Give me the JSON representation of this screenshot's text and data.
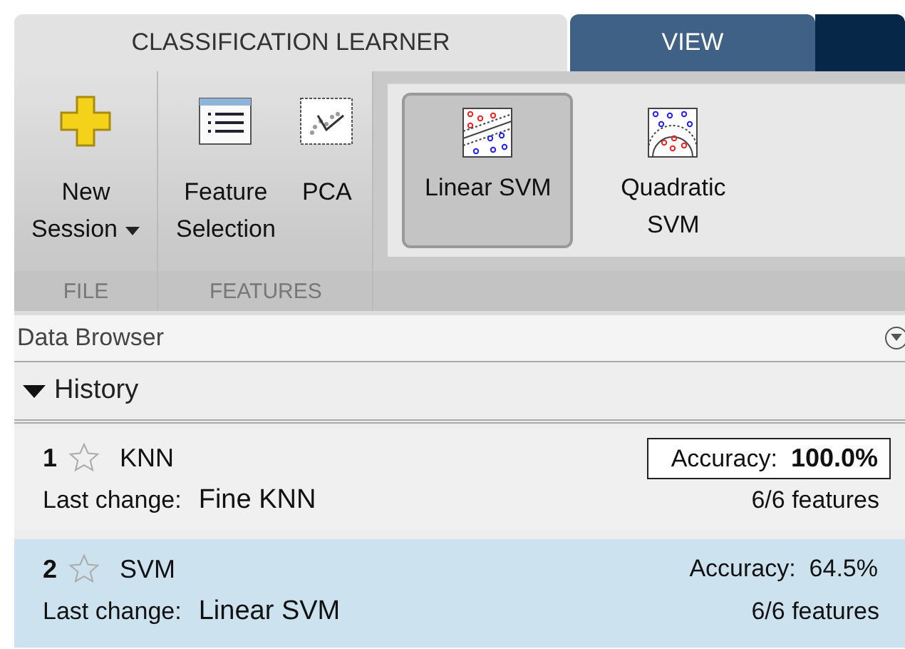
{
  "tabs": [
    {
      "label": "CLASSIFICATION LEARNER",
      "selected": true
    },
    {
      "label": "VIEW",
      "selected": false
    }
  ],
  "ribbon": {
    "sections": [
      {
        "label": "FILE",
        "buttons": [
          {
            "kind": "new",
            "label": [
              "New",
              "Session"
            ],
            "dropdown": true
          }
        ]
      },
      {
        "label": "FEATURES",
        "buttons": [
          {
            "kind": "feature",
            "label": [
              "Feature",
              "Selection"
            ],
            "dropdown": false
          },
          {
            "kind": "pca",
            "label": [
              "PCA"
            ],
            "dropdown": false
          }
        ]
      }
    ],
    "gallery": [
      {
        "kind": "linear-svm",
        "label": [
          "Linear SVM"
        ],
        "selected": true
      },
      {
        "kind": "quadratic-svm",
        "label": [
          "Quadratic",
          "SVM"
        ],
        "selected": false
      }
    ]
  },
  "data_browser": {
    "title": "Data Browser",
    "history": {
      "label": "History",
      "expanded": true,
      "models": [
        {
          "number": "1",
          "starred": false,
          "name": "KNN",
          "last_change_label": "Last change:",
          "last_change": "Fine KNN",
          "accuracy_label": "Accuracy:",
          "accuracy": "100.0%",
          "best": true,
          "features": "6/6 features",
          "selected": false
        },
        {
          "number": "2",
          "starred": false,
          "name": "SVM",
          "last_change_label": "Last change:",
          "last_change": "Linear SVM",
          "accuracy_label": "Accuracy:",
          "accuracy": "64.5%",
          "best": false,
          "features": "6/6 features",
          "selected": true
        }
      ]
    }
  }
}
